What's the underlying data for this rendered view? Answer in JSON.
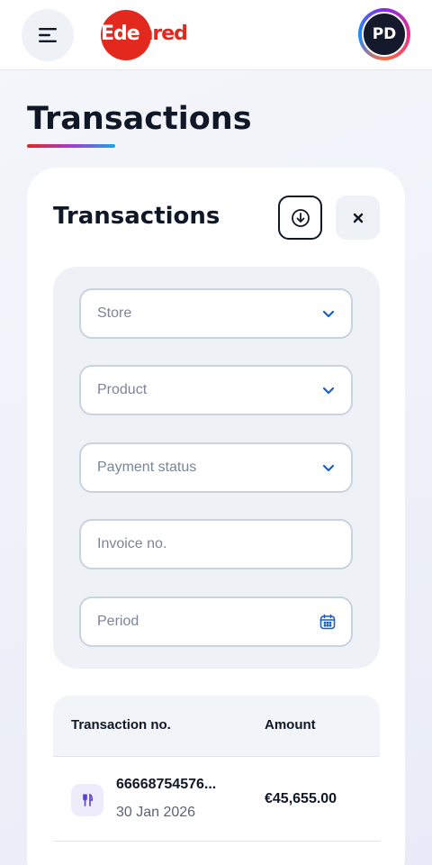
{
  "header": {
    "menu_icon": "hamburger-icon",
    "logo_text_part1": "Ede",
    "logo_text_part2": "nred",
    "avatar_initials": "PD",
    "brand_color": "#e3281e"
  },
  "page": {
    "title": "Transactions"
  },
  "panel": {
    "title": "Transactions",
    "download_icon": "download-icon",
    "close_icon": "close-icon"
  },
  "filters": {
    "store_placeholder": "Store",
    "product_placeholder": "Product",
    "payment_status_placeholder": "Payment status",
    "invoice_placeholder": "Invoice no.",
    "period_placeholder": "Period",
    "accent_color": "#1a5fc4"
  },
  "table": {
    "columns": [
      "Transaction no.",
      "Amount"
    ],
    "rows": [
      {
        "icon": "restaurant-icon",
        "transaction_no": "66668754576...",
        "date": "30 Jan 2026",
        "amount": "€45,655.00"
      }
    ]
  }
}
